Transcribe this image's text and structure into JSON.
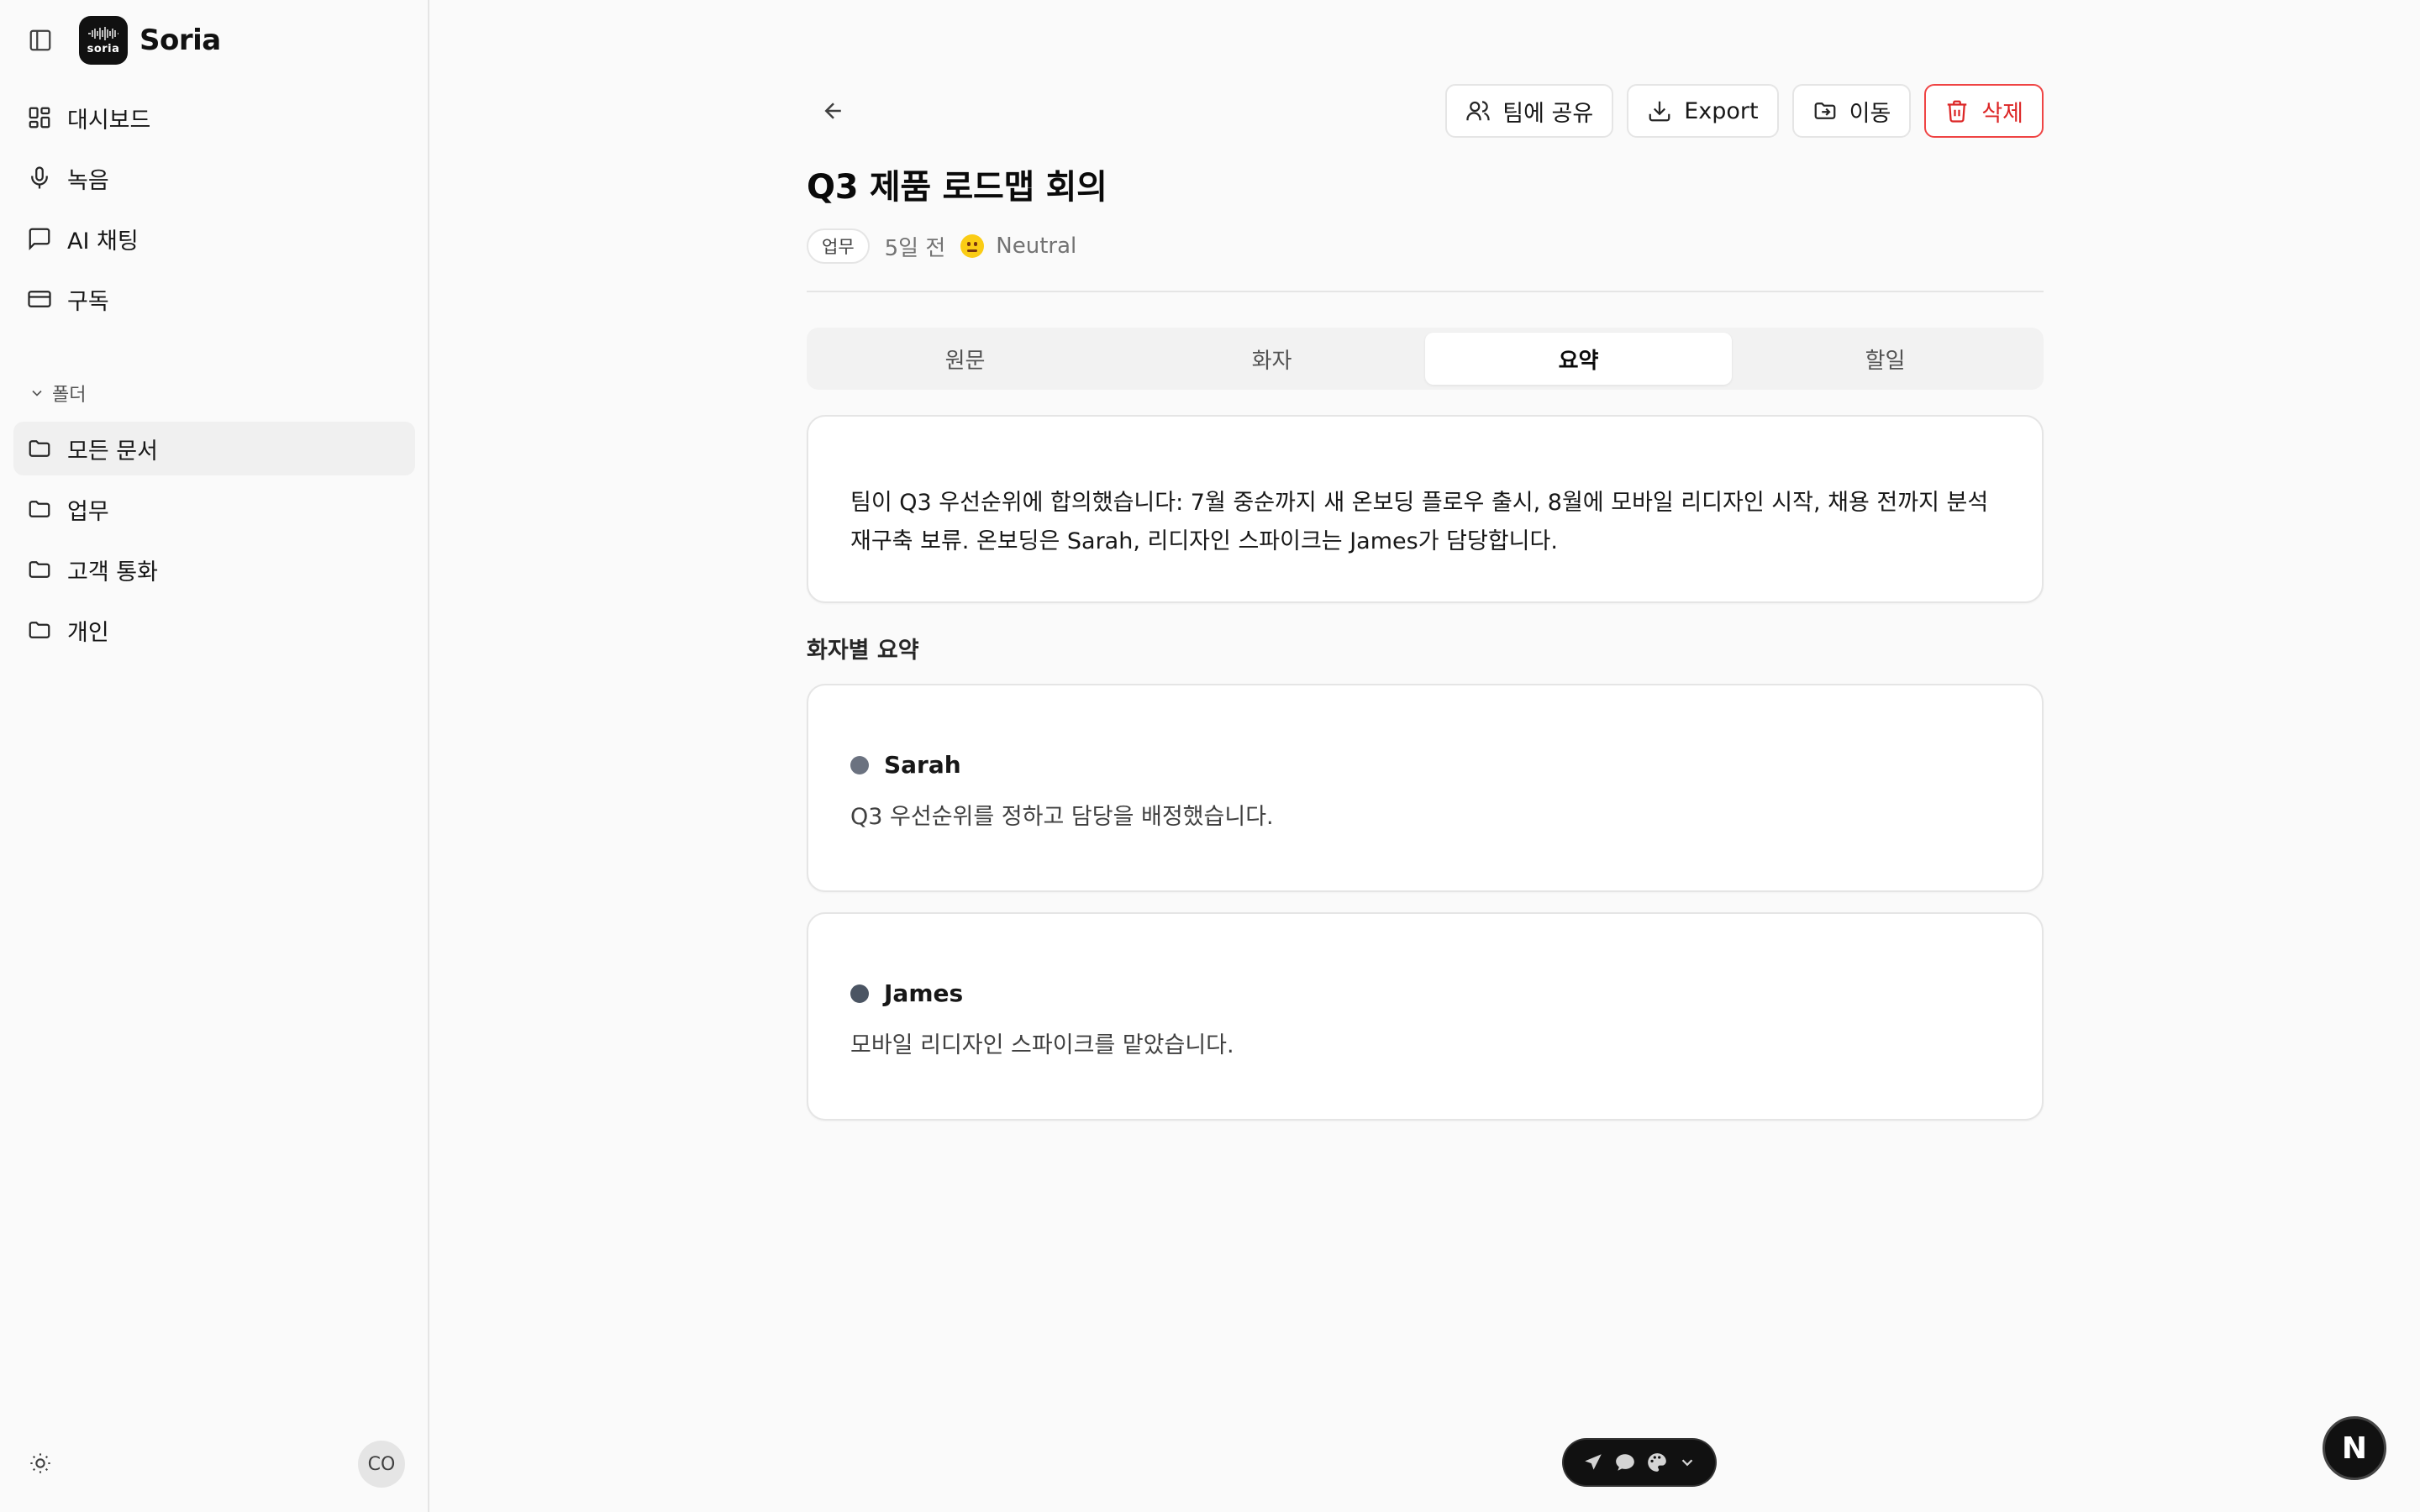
{
  "brand": {
    "name": "Soria",
    "logo_text": "soria"
  },
  "sidebar": {
    "nav": [
      {
        "label": "대시보드",
        "icon": "dashboard-icon"
      },
      {
        "label": "녹음",
        "icon": "mic-icon"
      },
      {
        "label": "AI 채팅",
        "icon": "chat-icon"
      },
      {
        "label": "구독",
        "icon": "card-icon"
      }
    ],
    "folders_label": "폴더",
    "folders": [
      {
        "label": "모든 문서",
        "active": true
      },
      {
        "label": "업무"
      },
      {
        "label": "고객 통화"
      },
      {
        "label": "개인"
      }
    ],
    "avatar": "CO"
  },
  "toolbar": {
    "share_label": "팀에 공유",
    "export_label": "Export",
    "move_label": "이동",
    "delete_label": "삭제"
  },
  "document": {
    "title": "Q3 제품 로드맵 회의",
    "tag": "업무",
    "date": "5일 전",
    "sentiment": "Neutral"
  },
  "tabs": [
    {
      "label": "원문"
    },
    {
      "label": "화자"
    },
    {
      "label": "요약",
      "active": true
    },
    {
      "label": "할일"
    }
  ],
  "summary": {
    "text": "팀이 Q3 우선순위에 합의했습니다: 7월 중순까지 새 온보딩 플로우 출시, 8월에 모바일 리디자인 시작, 채용 전까지 분석 재구축 보류. 온보딩은 Sarah, 리디자인 스파이크는 James가 담당합니다."
  },
  "speakers_label": "화자별 요약",
  "speakers": [
    {
      "name": "Sarah",
      "text": "Q3 우선순위를 정하고 담당을 배정했습니다.",
      "color": "#6b7280"
    },
    {
      "name": "James",
      "text": "모바일 리디자인 스파이크를 맡았습니다.",
      "color": "#4b5563"
    }
  ],
  "colors": {
    "danger": "#dc2626",
    "accent": "#111111"
  },
  "next_badge": "N"
}
